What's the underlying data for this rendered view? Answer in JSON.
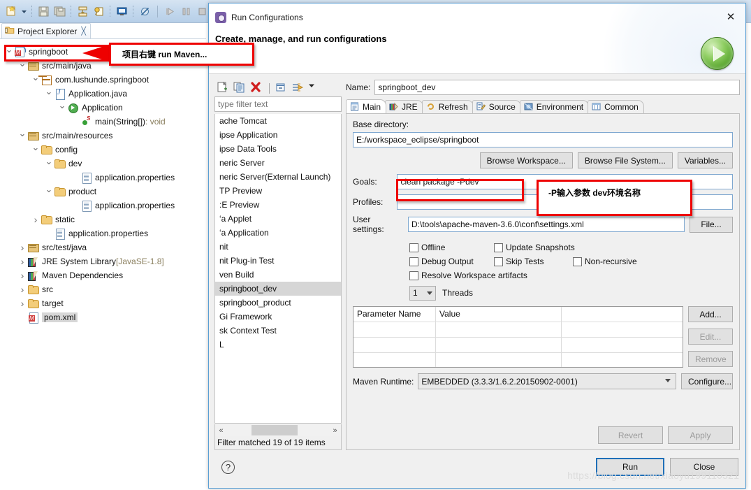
{
  "ide": {
    "toolbar_icons": [
      "new-wizard-icon",
      "new-dropdown-arrow-icon",
      "save-icon",
      "save-all-icon",
      "export-icon",
      "quick-access-icon",
      "console-icon",
      "skip-breakpoints-icon",
      "resume-icon",
      "suspend-icon",
      "terminate-icon",
      "debug-tree-icon"
    ],
    "view_tab": {
      "label": "Project Explorer",
      "close_glyph": "╳"
    },
    "tree": [
      {
        "indent": 0,
        "arrow": "open",
        "icon": "maven-project-icon",
        "label": "springboot",
        "dim": ""
      },
      {
        "indent": 1,
        "arrow": "open",
        "icon": "source-folder-icon",
        "label": "src/main/java",
        "dim": ""
      },
      {
        "indent": 2,
        "arrow": "open",
        "icon": "package-icon",
        "label": "com.lushunde.springboot",
        "dim": ""
      },
      {
        "indent": 3,
        "arrow": "open",
        "icon": "java-file-icon",
        "label": "Application.java",
        "dim": ""
      },
      {
        "indent": 4,
        "arrow": "open",
        "icon": "java-class-icon",
        "label": "Application",
        "dim": ""
      },
      {
        "indent": 5,
        "arrow": "none",
        "icon": "java-method-icon",
        "label": "main(String[])",
        "dim": " : void"
      },
      {
        "indent": 1,
        "arrow": "open",
        "icon": "source-folder-icon",
        "label": "src/main/resources",
        "dim": ""
      },
      {
        "indent": 2,
        "arrow": "open",
        "icon": "folder-icon",
        "label": "config",
        "dim": ""
      },
      {
        "indent": 3,
        "arrow": "open",
        "icon": "folder-icon",
        "label": "dev",
        "dim": ""
      },
      {
        "indent": 5,
        "arrow": "none",
        "icon": "properties-file-icon",
        "label": "application.properties",
        "dim": ""
      },
      {
        "indent": 3,
        "arrow": "open",
        "icon": "folder-icon",
        "label": "product",
        "dim": ""
      },
      {
        "indent": 5,
        "arrow": "none",
        "icon": "properties-file-icon",
        "label": "application.properties",
        "dim": ""
      },
      {
        "indent": 2,
        "arrow": "closed",
        "icon": "folder-icon",
        "label": "static",
        "dim": ""
      },
      {
        "indent": 3,
        "arrow": "none",
        "icon": "properties-file-icon",
        "label": "application.properties",
        "dim": ""
      },
      {
        "indent": 1,
        "arrow": "closed",
        "icon": "source-folder-icon",
        "label": "src/test/java",
        "dim": ""
      },
      {
        "indent": 1,
        "arrow": "closed",
        "icon": "library-icon",
        "label": "JRE System Library",
        "dim": " [JavaSE-1.8]"
      },
      {
        "indent": 1,
        "arrow": "closed",
        "icon": "library-icon",
        "label": "Maven Dependencies",
        "dim": ""
      },
      {
        "indent": 1,
        "arrow": "closed",
        "icon": "folder-icon",
        "label": "src",
        "dim": ""
      },
      {
        "indent": 1,
        "arrow": "closed",
        "icon": "folder-icon",
        "label": "target",
        "dim": ""
      },
      {
        "indent": 1,
        "arrow": "none",
        "icon": "pom-file-icon",
        "label": "pom.xml",
        "dim": "",
        "selected": true
      }
    ]
  },
  "dialog": {
    "title": "Run Configurations",
    "subtitle": "Create, manage, and run configurations",
    "close_glyph": "✕",
    "left_panel": {
      "toolbar_icons": [
        "new-config-icon",
        "duplicate-config-icon",
        "delete-config-icon",
        "collapse-all-icon",
        "filter-icon",
        "view-menu-arrow-icon"
      ],
      "filter_placeholder": "type filter text",
      "items": [
        {
          "label": "ache Tomcat"
        },
        {
          "label": "ipse Application"
        },
        {
          "label": "ipse Data Tools"
        },
        {
          "label": "neric Server"
        },
        {
          "label": "neric Server(External Launch)"
        },
        {
          "label": "TP Preview"
        },
        {
          "label": ":E Preview"
        },
        {
          "label": "‘a Applet"
        },
        {
          "label": "‘a Application"
        },
        {
          "label": "nit"
        },
        {
          "label": "nit Plug-in Test"
        },
        {
          "label": "ven Build"
        },
        {
          "label": "springboot_dev",
          "selected": true
        },
        {
          "label": "springboot_product"
        },
        {
          "label": "Gi Framework"
        },
        {
          "label": "sk Context Test"
        },
        {
          "label": "L"
        }
      ],
      "scroll_left_glyph": "«",
      "scroll_right_glyph": "»",
      "status": "Filter matched 19 of 19 items"
    },
    "name_label": "Name:",
    "name_value": "springboot_dev",
    "tabs": [
      {
        "label": "Main",
        "icon": "main-tab-icon",
        "active": true
      },
      {
        "label": "JRE",
        "icon": "jre-tab-icon",
        "active": false
      },
      {
        "label": "Refresh",
        "icon": "refresh-tab-icon",
        "active": false
      },
      {
        "label": "Source",
        "icon": "source-tab-icon",
        "active": false
      },
      {
        "label": "Environment",
        "icon": "environment-tab-icon",
        "active": false
      },
      {
        "label": "Common",
        "icon": "common-tab-icon",
        "active": false
      }
    ],
    "main_tab": {
      "base_directory_label": "Base directory:",
      "base_directory_value": "E:/workspace_eclipse/springboot",
      "browse_workspace_label": "Browse Workspace...",
      "browse_filesystem_label": "Browse File System...",
      "variables_label": "Variables...",
      "goals_label": "Goals:",
      "goals_value": "clean package -Pdev",
      "profiles_label": "Profiles:",
      "profiles_value": "",
      "user_settings_label": "User settings:",
      "user_settings_value": "D:\\tools\\apache-maven-3.6.0\\conf\\settings.xml",
      "file_button_label": "File...",
      "checkboxes": [
        {
          "label": "Offline",
          "checked": false
        },
        {
          "label": "Update Snapshots",
          "checked": false
        },
        {
          "label": "Debug Output",
          "checked": false
        },
        {
          "label": "Skip Tests",
          "checked": false
        },
        {
          "label": "Non-recursive",
          "checked": false
        },
        {
          "label": "Resolve Workspace artifacts",
          "checked": false
        }
      ],
      "threads_value": "1",
      "threads_label": "Threads",
      "table": {
        "columns": [
          "Parameter Name",
          "Value",
          ""
        ],
        "rows": []
      },
      "table_buttons": [
        {
          "label": "Add...",
          "enabled": true
        },
        {
          "label": "Edit...",
          "enabled": false
        },
        {
          "label": "Remove",
          "enabled": false
        }
      ],
      "maven_runtime_label": "Maven Runtime:",
      "maven_runtime_value": "EMBEDDED (3.3.3/1.6.2.20150902-0001)",
      "configure_label": "Configure..."
    },
    "revert_label": "Revert",
    "apply_label": "Apply",
    "help_glyph": "?",
    "run_label": "Run",
    "close_label": "Close"
  },
  "annotations": {
    "callout1_text": "项目右键 run Maven...",
    "callout2_text": "-P输入参数  dev环境名称",
    "highlight_color": "#ee0000"
  },
  "watermark": "https://blog.csdn.net/xiaoyu199110321"
}
